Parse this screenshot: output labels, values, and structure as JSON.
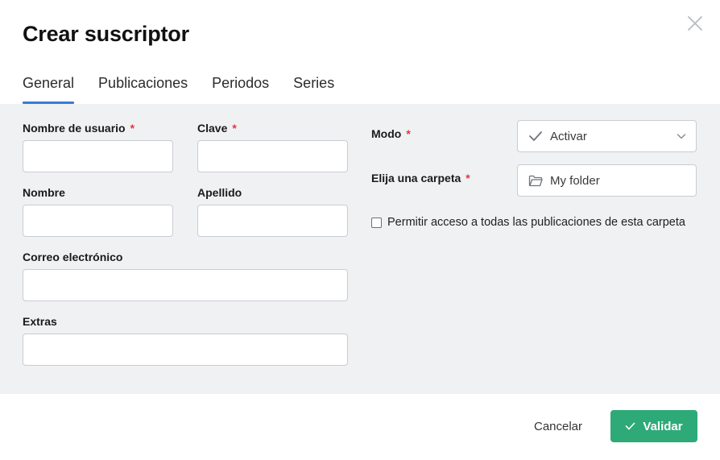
{
  "dialog": {
    "title": "Crear suscriptor"
  },
  "tabs": [
    {
      "label": "General",
      "active": true
    },
    {
      "label": "Publicaciones",
      "active": false
    },
    {
      "label": "Periodos",
      "active": false
    },
    {
      "label": "Series",
      "active": false
    }
  ],
  "form": {
    "username_label": "Nombre de usuario",
    "password_label": "Clave",
    "firstname_label": "Nombre",
    "lastname_label": "Apellido",
    "email_label": "Correo electrónico",
    "extras_label": "Extras",
    "required_mark": "*",
    "mode_label": "Modo",
    "mode_value": "Activar",
    "folder_label": "Elija una carpeta",
    "folder_value": "My folder",
    "access_checkbox_label": "Permitir acceso a todas las publicaciones de esta carpeta",
    "access_checkbox_checked": false
  },
  "footer": {
    "cancel_label": "Cancelar",
    "validate_label": "Validar"
  },
  "colors": {
    "accent": "#3a7bd5",
    "required": "#e0383e",
    "validate": "#2eaa78",
    "body_bg": "#f0f1f3"
  },
  "icons": {
    "close": "close-icon",
    "mode": "check-icon",
    "chevron": "chevron-down-icon",
    "folder": "folder-icon",
    "validate": "check-icon"
  }
}
